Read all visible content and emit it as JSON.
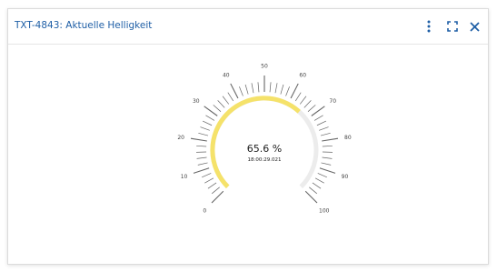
{
  "widget": {
    "title": "TXT-4843: Aktuelle Helligkeit",
    "menu_icon": "vertical-dots-icon",
    "fullscreen_icon": "expand-icon",
    "close_icon": "close-icon"
  },
  "gauge": {
    "value": 65.6,
    "value_text": "65.6 %",
    "timestamp": "18:00:29.021",
    "min": 0,
    "max": 100,
    "labels": [
      "0",
      "10",
      "20",
      "30",
      "40",
      "50",
      "60",
      "70",
      "80",
      "90",
      "100"
    ],
    "fill_color": "#f5e26a",
    "track_color": "#ececec",
    "tick_color": "#666666",
    "text_color": "#222222"
  }
}
